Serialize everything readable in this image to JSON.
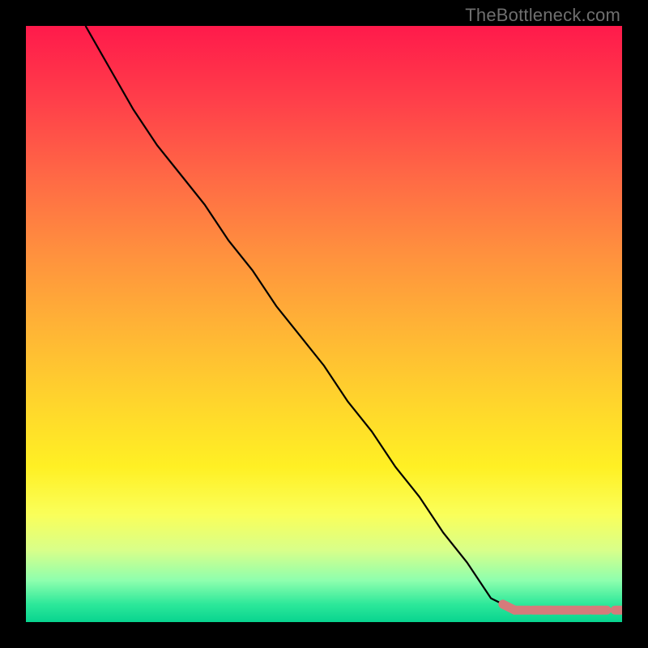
{
  "watermark": "TheBottleneck.com",
  "chart_data": {
    "type": "line",
    "title": "",
    "xlabel": "",
    "ylabel": "",
    "xlim": [
      0,
      100
    ],
    "ylim": [
      0,
      100
    ],
    "grid": false,
    "legend": false,
    "series": [
      {
        "name": "bottleneck-curve",
        "color": "#000000",
        "x": [
          10,
          14,
          18,
          22,
          26,
          30,
          34,
          38,
          42,
          46,
          50,
          54,
          58,
          62,
          66,
          70,
          74,
          78,
          80,
          82,
          85,
          88,
          90,
          92,
          95,
          100
        ],
        "y": [
          100,
          93,
          86,
          80,
          75,
          70,
          64,
          59,
          53,
          48,
          43,
          37,
          32,
          26,
          21,
          15,
          10,
          4,
          3,
          2,
          2,
          2,
          2,
          2,
          2,
          2
        ]
      },
      {
        "name": "tail-markers",
        "color": "#d57b7b",
        "marker": "circle",
        "x": [
          80,
          82,
          85,
          87,
          88,
          90,
          92,
          95,
          100
        ],
        "y": [
          3,
          2,
          2,
          2,
          2,
          2,
          2,
          2,
          2
        ]
      }
    ]
  }
}
